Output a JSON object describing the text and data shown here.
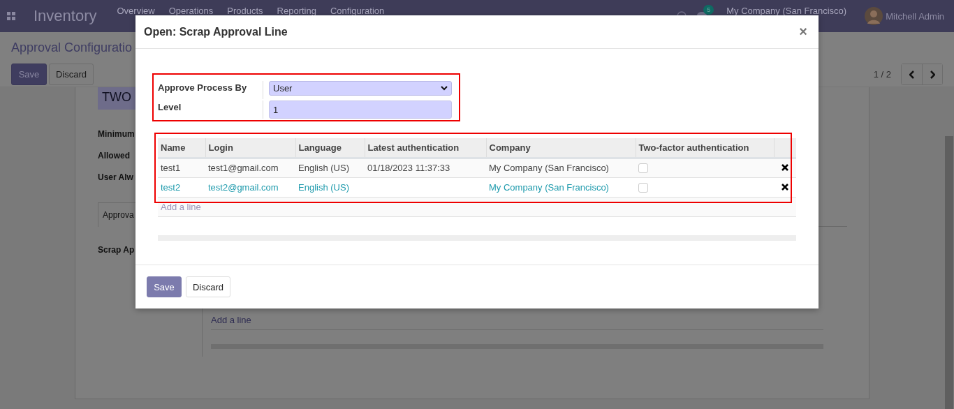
{
  "navbar": {
    "app_name": "Inventory",
    "menu": [
      "Overview",
      "Operations",
      "Products",
      "Reporting",
      "Configuration"
    ],
    "notification_count": "5",
    "company": "My Company (San Francisco)",
    "user": "Mitchell Admin"
  },
  "background": {
    "breadcrumb": "Approval Configuratio",
    "buttons": [
      "Save",
      "Discard"
    ],
    "pager": "1 / 2",
    "title": "TWO",
    "fields": [
      "Minimum",
      "Allowed",
      "User Alw"
    ],
    "tab": "Approva",
    "section": "Scrap Ap",
    "add_line": "Add a line"
  },
  "dialog": {
    "title": "Open: Scrap Approval Line",
    "close": "×",
    "fields": [
      {
        "label": "Approve Process By",
        "kind": "select",
        "value": "User"
      },
      {
        "label": "Level",
        "kind": "input",
        "value": "1"
      }
    ],
    "table": {
      "columns": [
        "Name",
        "Login",
        "Language",
        "Latest authentication",
        "Company",
        "Two-factor authentication"
      ],
      "rows": [
        {
          "cells": [
            "test1",
            "test1@gmail.com",
            "English (US)",
            "01/18/2023 11:37:33",
            "My Company (San Francisco)"
          ],
          "two_factor": false,
          "selected": false
        },
        {
          "cells": [
            "test2",
            "test2@gmail.com",
            "English (US)",
            "",
            "My Company (San Francisco)"
          ],
          "two_factor": false,
          "selected": true
        }
      ],
      "add_line": "Add a line"
    },
    "buttons": [
      {
        "label": "Save",
        "primary": true
      },
      {
        "label": "Discard",
        "primary": false
      }
    ]
  }
}
